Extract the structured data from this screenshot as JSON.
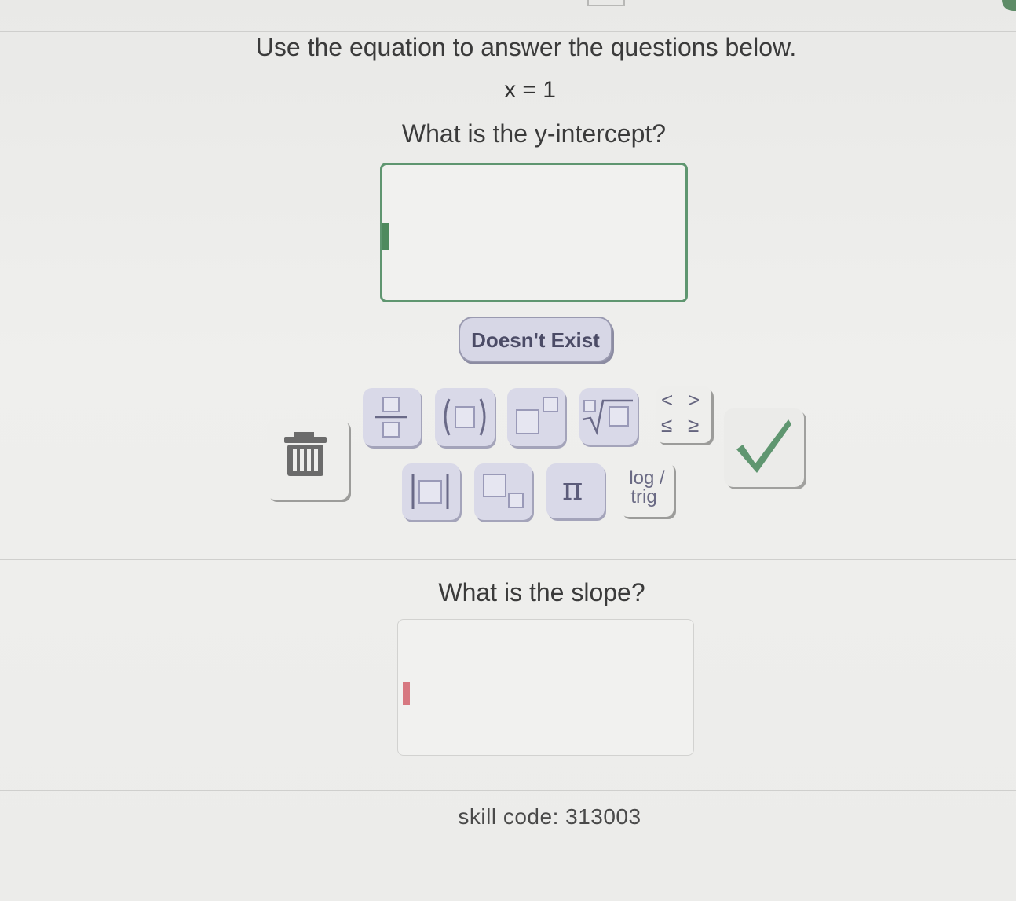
{
  "prompt": {
    "instruction": "Use the equation to answer the questions below.",
    "equation": "x = 1"
  },
  "questions": [
    {
      "label": "What is the y-intercept?",
      "answer_value": "",
      "state": "active"
    },
    {
      "label": "What is the slope?",
      "answer_value": "",
      "state": "inactive"
    }
  ],
  "doesnt_exist_button": {
    "label": "Doesn't Exist"
  },
  "keypad": {
    "keys_row1": [
      {
        "name": "fraction-key",
        "icon": "fraction-icon"
      },
      {
        "name": "parentheses-key",
        "icon": "parentheses-icon"
      },
      {
        "name": "exponent-key",
        "icon": "exponent-icon"
      },
      {
        "name": "nth-root-key",
        "icon": "nth-root-icon"
      }
    ],
    "keys_row2": [
      {
        "name": "absolute-value-key",
        "icon": "absolute-value-icon"
      },
      {
        "name": "subscript-key",
        "icon": "subscript-icon"
      },
      {
        "name": "pi-key",
        "label": "π"
      },
      {
        "name": "log-trig-key",
        "label_top": "log /",
        "label_bottom": "trig"
      }
    ],
    "inequality_symbols": {
      "less": "<",
      "greater": ">",
      "less_equal": "≤",
      "greater_equal": "≥"
    },
    "trash_icon": "trash-icon",
    "check_icon": "check-icon",
    "accent_color": "#5f9670",
    "key_color": "#d9d9e8"
  },
  "footer": {
    "skill_code": "skill code: 313003"
  }
}
